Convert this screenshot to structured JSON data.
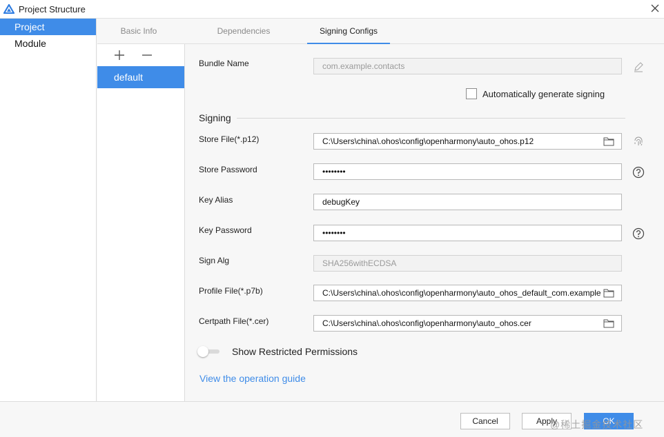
{
  "window": {
    "title": "Project Structure"
  },
  "nav": {
    "items": [
      {
        "label": "Project"
      },
      {
        "label": "Module"
      }
    ]
  },
  "tabs": [
    {
      "label": "Basic Info"
    },
    {
      "label": "Dependencies"
    },
    {
      "label": "Signing Configs"
    }
  ],
  "configs": {
    "items": [
      {
        "label": "default"
      }
    ]
  },
  "form": {
    "bundle_name_label": "Bundle Name",
    "bundle_name_value": "com.example.contacts",
    "auto_sign_label": "Automatically generate signing",
    "signing_section": "Signing",
    "store_file_label": "Store File(*.p12)",
    "store_file_value": "C:\\Users\\china\\.ohos\\config\\openharmony\\auto_ohos.p12",
    "store_password_label": "Store Password",
    "store_password_value": "••••••••",
    "key_alias_label": "Key Alias",
    "key_alias_value": "debugKey",
    "key_password_label": "Key Password",
    "key_password_value": "••••••••",
    "sign_alg_label": "Sign Alg",
    "sign_alg_value": "SHA256withECDSA",
    "profile_file_label": "Profile File(*.p7b)",
    "profile_file_value": "C:\\Users\\china\\.ohos\\config\\openharmony\\auto_ohos_default_com.example",
    "certpath_file_label": "Certpath File(*.cer)",
    "certpath_file_value": "C:\\Users\\china\\.ohos\\config\\openharmony\\auto_ohos.cer",
    "restricted_label": "Show Restricted Permissions",
    "guide_link": "View the operation guide"
  },
  "footer": {
    "cancel": "Cancel",
    "apply": "Apply",
    "ok": "OK"
  },
  "watermark": "@稀土掘金技术社区",
  "colors": {
    "accent": "#3f8ce8",
    "background": "#f7f7f7"
  }
}
